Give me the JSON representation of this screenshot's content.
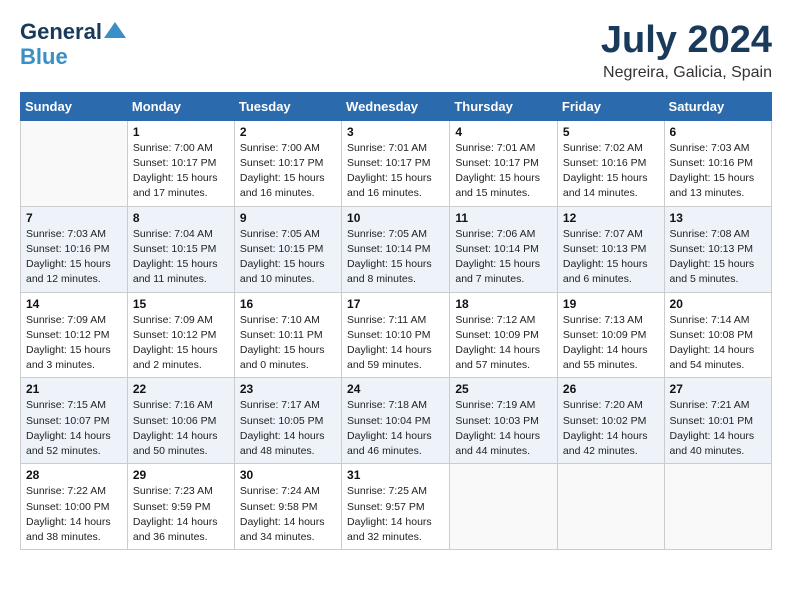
{
  "header": {
    "logo_general": "General",
    "logo_blue": "Blue",
    "month_year": "July 2024",
    "location": "Negreira, Galicia, Spain"
  },
  "weekdays": [
    "Sunday",
    "Monday",
    "Tuesday",
    "Wednesday",
    "Thursday",
    "Friday",
    "Saturday"
  ],
  "weeks": [
    [
      {
        "day": "",
        "sunrise": "",
        "sunset": "",
        "daylight": ""
      },
      {
        "day": "1",
        "sunrise": "Sunrise: 7:00 AM",
        "sunset": "Sunset: 10:17 PM",
        "daylight": "Daylight: 15 hours and 17 minutes."
      },
      {
        "day": "2",
        "sunrise": "Sunrise: 7:00 AM",
        "sunset": "Sunset: 10:17 PM",
        "daylight": "Daylight: 15 hours and 16 minutes."
      },
      {
        "day": "3",
        "sunrise": "Sunrise: 7:01 AM",
        "sunset": "Sunset: 10:17 PM",
        "daylight": "Daylight: 15 hours and 16 minutes."
      },
      {
        "day": "4",
        "sunrise": "Sunrise: 7:01 AM",
        "sunset": "Sunset: 10:17 PM",
        "daylight": "Daylight: 15 hours and 15 minutes."
      },
      {
        "day": "5",
        "sunrise": "Sunrise: 7:02 AM",
        "sunset": "Sunset: 10:16 PM",
        "daylight": "Daylight: 15 hours and 14 minutes."
      },
      {
        "day": "6",
        "sunrise": "Sunrise: 7:03 AM",
        "sunset": "Sunset: 10:16 PM",
        "daylight": "Daylight: 15 hours and 13 minutes."
      }
    ],
    [
      {
        "day": "7",
        "sunrise": "Sunrise: 7:03 AM",
        "sunset": "Sunset: 10:16 PM",
        "daylight": "Daylight: 15 hours and 12 minutes."
      },
      {
        "day": "8",
        "sunrise": "Sunrise: 7:04 AM",
        "sunset": "Sunset: 10:15 PM",
        "daylight": "Daylight: 15 hours and 11 minutes."
      },
      {
        "day": "9",
        "sunrise": "Sunrise: 7:05 AM",
        "sunset": "Sunset: 10:15 PM",
        "daylight": "Daylight: 15 hours and 10 minutes."
      },
      {
        "day": "10",
        "sunrise": "Sunrise: 7:05 AM",
        "sunset": "Sunset: 10:14 PM",
        "daylight": "Daylight: 15 hours and 8 minutes."
      },
      {
        "day": "11",
        "sunrise": "Sunrise: 7:06 AM",
        "sunset": "Sunset: 10:14 PM",
        "daylight": "Daylight: 15 hours and 7 minutes."
      },
      {
        "day": "12",
        "sunrise": "Sunrise: 7:07 AM",
        "sunset": "Sunset: 10:13 PM",
        "daylight": "Daylight: 15 hours and 6 minutes."
      },
      {
        "day": "13",
        "sunrise": "Sunrise: 7:08 AM",
        "sunset": "Sunset: 10:13 PM",
        "daylight": "Daylight: 15 hours and 5 minutes."
      }
    ],
    [
      {
        "day": "14",
        "sunrise": "Sunrise: 7:09 AM",
        "sunset": "Sunset: 10:12 PM",
        "daylight": "Daylight: 15 hours and 3 minutes."
      },
      {
        "day": "15",
        "sunrise": "Sunrise: 7:09 AM",
        "sunset": "Sunset: 10:12 PM",
        "daylight": "Daylight: 15 hours and 2 minutes."
      },
      {
        "day": "16",
        "sunrise": "Sunrise: 7:10 AM",
        "sunset": "Sunset: 10:11 PM",
        "daylight": "Daylight: 15 hours and 0 minutes."
      },
      {
        "day": "17",
        "sunrise": "Sunrise: 7:11 AM",
        "sunset": "Sunset: 10:10 PM",
        "daylight": "Daylight: 14 hours and 59 minutes."
      },
      {
        "day": "18",
        "sunrise": "Sunrise: 7:12 AM",
        "sunset": "Sunset: 10:09 PM",
        "daylight": "Daylight: 14 hours and 57 minutes."
      },
      {
        "day": "19",
        "sunrise": "Sunrise: 7:13 AM",
        "sunset": "Sunset: 10:09 PM",
        "daylight": "Daylight: 14 hours and 55 minutes."
      },
      {
        "day": "20",
        "sunrise": "Sunrise: 7:14 AM",
        "sunset": "Sunset: 10:08 PM",
        "daylight": "Daylight: 14 hours and 54 minutes."
      }
    ],
    [
      {
        "day": "21",
        "sunrise": "Sunrise: 7:15 AM",
        "sunset": "Sunset: 10:07 PM",
        "daylight": "Daylight: 14 hours and 52 minutes."
      },
      {
        "day": "22",
        "sunrise": "Sunrise: 7:16 AM",
        "sunset": "Sunset: 10:06 PM",
        "daylight": "Daylight: 14 hours and 50 minutes."
      },
      {
        "day": "23",
        "sunrise": "Sunrise: 7:17 AM",
        "sunset": "Sunset: 10:05 PM",
        "daylight": "Daylight: 14 hours and 48 minutes."
      },
      {
        "day": "24",
        "sunrise": "Sunrise: 7:18 AM",
        "sunset": "Sunset: 10:04 PM",
        "daylight": "Daylight: 14 hours and 46 minutes."
      },
      {
        "day": "25",
        "sunrise": "Sunrise: 7:19 AM",
        "sunset": "Sunset: 10:03 PM",
        "daylight": "Daylight: 14 hours and 44 minutes."
      },
      {
        "day": "26",
        "sunrise": "Sunrise: 7:20 AM",
        "sunset": "Sunset: 10:02 PM",
        "daylight": "Daylight: 14 hours and 42 minutes."
      },
      {
        "day": "27",
        "sunrise": "Sunrise: 7:21 AM",
        "sunset": "Sunset: 10:01 PM",
        "daylight": "Daylight: 14 hours and 40 minutes."
      }
    ],
    [
      {
        "day": "28",
        "sunrise": "Sunrise: 7:22 AM",
        "sunset": "Sunset: 10:00 PM",
        "daylight": "Daylight: 14 hours and 38 minutes."
      },
      {
        "day": "29",
        "sunrise": "Sunrise: 7:23 AM",
        "sunset": "Sunset: 9:59 PM",
        "daylight": "Daylight: 14 hours and 36 minutes."
      },
      {
        "day": "30",
        "sunrise": "Sunrise: 7:24 AM",
        "sunset": "Sunset: 9:58 PM",
        "daylight": "Daylight: 14 hours and 34 minutes."
      },
      {
        "day": "31",
        "sunrise": "Sunrise: 7:25 AM",
        "sunset": "Sunset: 9:57 PM",
        "daylight": "Daylight: 14 hours and 32 minutes."
      },
      {
        "day": "",
        "sunrise": "",
        "sunset": "",
        "daylight": ""
      },
      {
        "day": "",
        "sunrise": "",
        "sunset": "",
        "daylight": ""
      },
      {
        "day": "",
        "sunrise": "",
        "sunset": "",
        "daylight": ""
      }
    ]
  ]
}
